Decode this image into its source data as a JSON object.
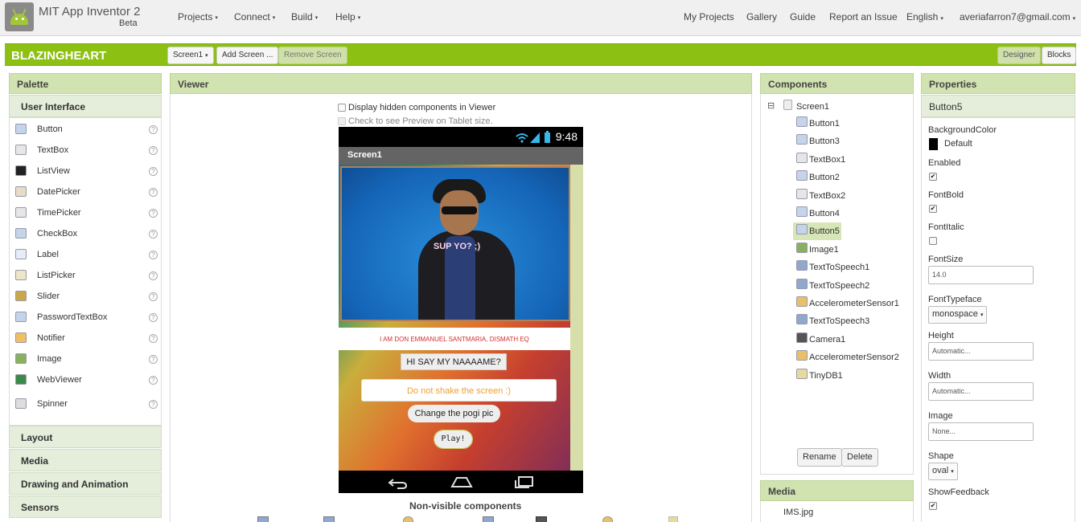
{
  "app": {
    "title": "MIT App Inventor 2",
    "beta": "Beta"
  },
  "menus": [
    "Projects",
    "Connect",
    "Build",
    "Help"
  ],
  "top_links": [
    "My Projects",
    "Gallery",
    "Guide",
    "Report an Issue",
    "English",
    "averiafarron7@gmail.com"
  ],
  "project": {
    "name": "BLAZINGHEART",
    "screen_select": "Screen1",
    "add_screen": "Add Screen ...",
    "remove_screen": "Remove Screen",
    "designer": "Designer",
    "blocks": "Blocks"
  },
  "palette": {
    "header": "Palette",
    "category": "User Interface",
    "items": [
      "Button",
      "TextBox",
      "ListView",
      "DatePicker",
      "TimePicker",
      "CheckBox",
      "Label",
      "ListPicker",
      "Slider",
      "PasswordTextBox",
      "Notifier",
      "Image",
      "WebViewer",
      "Spinner"
    ],
    "help": "?",
    "categories": [
      "Layout",
      "Media",
      "Drawing and Animation",
      "Sensors"
    ]
  },
  "viewer": {
    "header": "Viewer",
    "hidden_components": "Display hidden components in Viewer",
    "tablet_preview": "Check to see Preview on Tablet size.",
    "time": "9:48",
    "screen_title": "Screen1",
    "photo_caption": "SUP YO? ;)",
    "label_text": "I AM DON EMMANUEL SANTMARIA, DISMATH EQ",
    "btn_name": "HI SAY MY NAAAAME?",
    "textbox_hint": "Do not shake the screen :)",
    "btn_change": "Change the pogi pic",
    "btn_play": "Play!",
    "nonvisible": "Non-visible components"
  },
  "components": {
    "header": "Components",
    "root": "Screen1",
    "collapse": "⊟",
    "items": [
      "Button1",
      "Button3",
      "TextBox1",
      "Button2",
      "TextBox2",
      "Button4",
      "Button5",
      "Image1",
      "TextToSpeech1",
      "TextToSpeech2",
      "AccelerometerSensor1",
      "TextToSpeech3",
      "Camera1",
      "AccelerometerSensor2",
      "TinyDB1"
    ],
    "selected": "Button5",
    "rename": "Rename",
    "delete": "Delete"
  },
  "media": {
    "header": "Media",
    "items": [
      "IMS.jpg"
    ]
  },
  "properties": {
    "header": "Properties",
    "component": "Button5",
    "background_color_label": "BackgroundColor",
    "background_color_value": "Default",
    "enabled_label": "Enabled",
    "fontbold_label": "FontBold",
    "fontitalic_label": "FontItalic",
    "fontsize_label": "FontSize",
    "fontsize_value": "14.0",
    "fonttypeface_label": "FontTypeface",
    "fonttypeface_value": "monospace",
    "height_label": "Height",
    "height_value": "Automatic...",
    "width_label": "Width",
    "width_value": "Automatic...",
    "image_label": "Image",
    "image_value": "None...",
    "shape_label": "Shape",
    "shape_value": "oval",
    "showfeedback_label": "ShowFeedback",
    "check_mark": "✔",
    "caret": "▾"
  },
  "colors": {
    "accent_green": "#8cc012",
    "panel_header": "#d0e3b0",
    "selected": "#d7e6b6"
  }
}
